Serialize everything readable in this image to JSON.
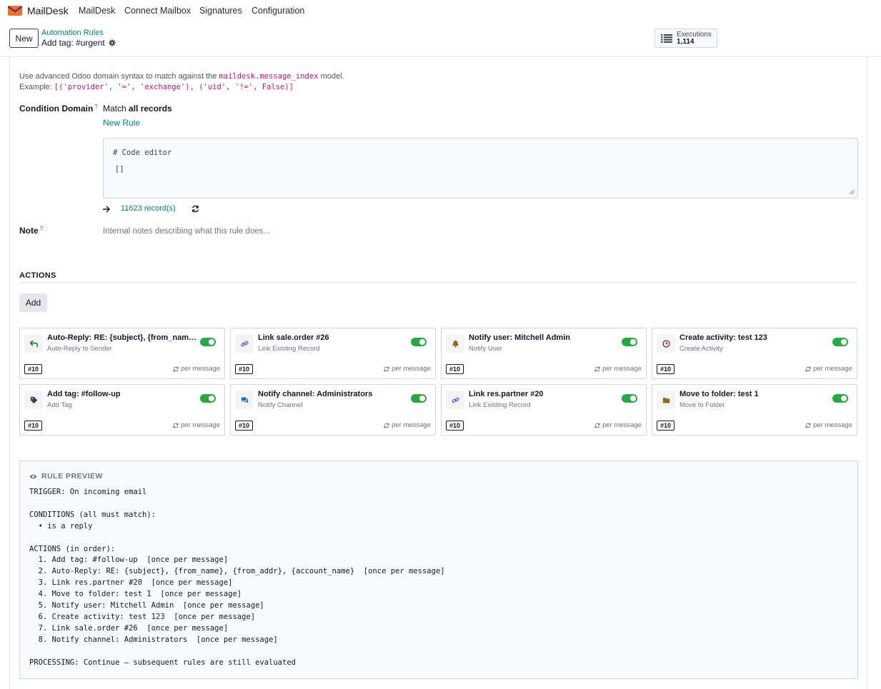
{
  "nav": {
    "brand": "MailDesk",
    "items": [
      "MailDesk",
      "Connect Mailbox",
      "Signatures",
      "Configuration"
    ]
  },
  "control": {
    "new_label": "New",
    "breadcrumb_parent": "Automation Rules",
    "breadcrumb_current": "Add tag: #urgent",
    "executions_label": "Executions",
    "executions_count": "1,114"
  },
  "form": {
    "help_prefix": "Use advanced Odoo domain syntax to match against the ",
    "help_model": "maildesk.message_index",
    "help_suffix": " model.",
    "example_label": "Example: ",
    "example_code": "[('provider', '=', 'exchange'), ('uid', '!=', False)]",
    "condition_label": "Condition Domain",
    "help_mark": "?",
    "match_prefix": "Match ",
    "match_bold": "all records",
    "new_rule": "New Rule",
    "code_comment": "# Code editor",
    "code_value": "[]",
    "record_count": "11623 record(s)",
    "note_label": "Note",
    "note_placeholder": "Internal notes describing what this rule does..."
  },
  "actions": {
    "section_title": "ACTIONS",
    "add_label": "Add",
    "cards": [
      {
        "title": "Auto-Reply: RE: {subject}, {from_name}, {from_addr}, {account_name}",
        "subtitle": "Auto-Reply to Sender",
        "seq": "#10",
        "freq": "per message",
        "icon": "reply-icon",
        "icon_color": "#2e7d32",
        "enabled": true
      },
      {
        "title": "Link sale.order #26",
        "subtitle": "Link Existing Record",
        "seq": "#10",
        "freq": "per message",
        "icon": "link-icon",
        "icon_color": "#7c5cd6",
        "enabled": true
      },
      {
        "title": "Notify user: Mitchell Admin",
        "subtitle": "Notify User",
        "seq": "#10",
        "freq": "per message",
        "icon": "bell-icon",
        "icon_color": "#8a6d1b",
        "enabled": true
      },
      {
        "title": "Create activity: test 123",
        "subtitle": "Create Activity",
        "seq": "#10",
        "freq": "per message",
        "icon": "clock-icon",
        "icon_color": "#8b1e3f",
        "enabled": true
      },
      {
        "title": "Add tag: #follow-up",
        "subtitle": "Add Tag",
        "seq": "#10",
        "freq": "per message",
        "icon": "tag-icon",
        "icon_color": "#5b2a5b",
        "enabled": true
      },
      {
        "title": "Notify channel: Administrators",
        "subtitle": "Notify Channel",
        "seq": "#10",
        "freq": "per message",
        "icon": "comments-icon",
        "icon_color": "#1f6fb2",
        "enabled": true
      },
      {
        "title": "Link res.partner #20",
        "subtitle": "Link Existing Record",
        "seq": "#10",
        "freq": "per message",
        "icon": "link-icon",
        "icon_color": "#7c5cd6",
        "enabled": true
      },
      {
        "title": "Move to folder: test 1",
        "subtitle": "Move to Folder",
        "seq": "#10",
        "freq": "per message",
        "icon": "folder-icon",
        "icon_color": "#8a6d1b",
        "enabled": true
      }
    ]
  },
  "preview": {
    "title": "RULE PREVIEW",
    "lines": [
      "TRIGGER: On incoming email",
      "",
      "CONDITIONS (all must match):",
      "  • is a reply",
      "",
      "ACTIONS (in order):",
      "  1. Add tag: #follow-up  [once per message]",
      "  2. Auto-Reply: RE: {subject}, {from_name}, {from_addr}, {account_name}  [once per message]",
      "  3. Link res.partner #20  [once per message]",
      "  4. Move to folder: test 1  [once per message]",
      "  5. Notify user: Mitchell Admin  [once per message]",
      "  6. Create activity: test 123  [once per message]",
      "  7. Link sale.order #26  [once per message]",
      "  8. Notify channel: Administrators  [once per message]",
      "",
      "PROCESSING: Continue — subsequent rules are still evaluated"
    ]
  },
  "colors": {
    "accent": "#017e84",
    "toggle_on": "#28a745",
    "code_red": "#c0176c"
  }
}
